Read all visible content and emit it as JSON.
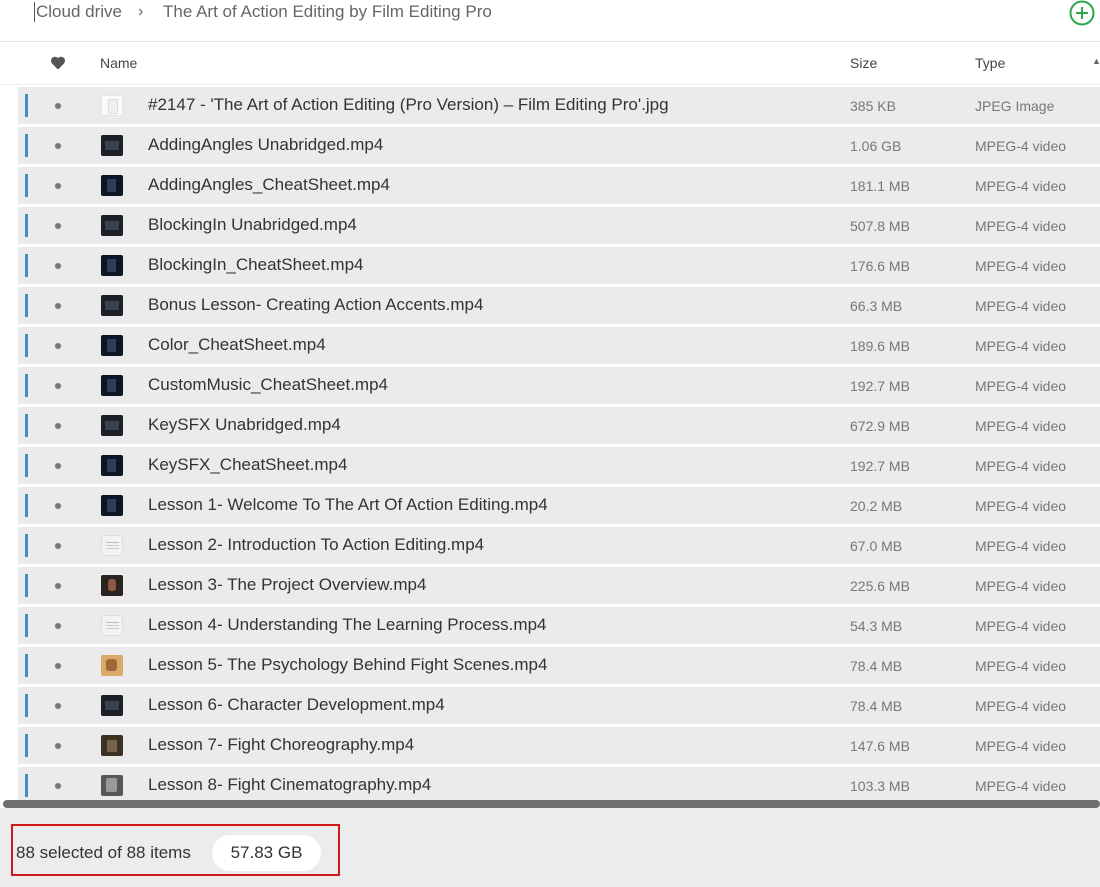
{
  "breadcrumb": {
    "root": "Cloud drive",
    "separator": "›",
    "current": "The Art of Action Editing by Film Editing Pro"
  },
  "header": {
    "favorite_icon": "heart-icon",
    "name": "Name",
    "size": "Size",
    "type": "Type",
    "sort_icon": "sort-ascending-icon"
  },
  "colors": {
    "accent": "#2ba84a",
    "row_marker": "#3f8fc0",
    "row_bg": "#ebebeb",
    "highlight_border": "#d01919"
  },
  "files": [
    {
      "name": "#2147 - 'The Art of Action Editing (Pro Version) – Film Editing Pro'.jpg",
      "size": "385 KB",
      "type": "JPEG Image",
      "thumb": "white"
    },
    {
      "name": "AddingAngles Unabridged.mp4",
      "size": "1.06 GB",
      "type": "MPEG-4 video",
      "thumb": "dark"
    },
    {
      "name": "AddingAngles_CheatSheet.mp4",
      "size": "181.1 MB",
      "type": "MPEG-4 video",
      "thumb": "blue"
    },
    {
      "name": "BlockingIn Unabridged.mp4",
      "size": "507.8 MB",
      "type": "MPEG-4 video",
      "thumb": "dark"
    },
    {
      "name": "BlockingIn_CheatSheet.mp4",
      "size": "176.6 MB",
      "type": "MPEG-4 video",
      "thumb": "blue"
    },
    {
      "name": "Bonus Lesson- Creating Action Accents.mp4",
      "size": "66.3 MB",
      "type": "MPEG-4 video",
      "thumb": "dark"
    },
    {
      "name": "Color_CheatSheet.mp4",
      "size": "189.6 MB",
      "type": "MPEG-4 video",
      "thumb": "blue"
    },
    {
      "name": "CustomMusic_CheatSheet.mp4",
      "size": "192.7 MB",
      "type": "MPEG-4 video",
      "thumb": "blue"
    },
    {
      "name": "KeySFX Unabridged.mp4",
      "size": "672.9 MB",
      "type": "MPEG-4 video",
      "thumb": "dark"
    },
    {
      "name": "KeySFX_CheatSheet.mp4",
      "size": "192.7 MB",
      "type": "MPEG-4 video",
      "thumb": "blue"
    },
    {
      "name": "Lesson 1- Welcome To The Art Of Action Editing.mp4",
      "size": "20.2 MB",
      "type": "MPEG-4 video",
      "thumb": "blue"
    },
    {
      "name": "Lesson 2- Introduction To Action Editing.mp4",
      "size": "67.0 MB",
      "type": "MPEG-4 video",
      "thumb": "light"
    },
    {
      "name": "Lesson 3- The Project Overview.mp4",
      "size": "225.6 MB",
      "type": "MPEG-4 video",
      "thumb": "face"
    },
    {
      "name": "Lesson 4- Understanding The Learning Process.mp4",
      "size": "54.3 MB",
      "type": "MPEG-4 video",
      "thumb": "light"
    },
    {
      "name": "Lesson 5- The Psychology Behind Fight Scenes.mp4",
      "size": "78.4 MB",
      "type": "MPEG-4 video",
      "thumb": "warm"
    },
    {
      "name": "Lesson 6- Character Development.mp4",
      "size": "78.4 MB",
      "type": "MPEG-4 video",
      "thumb": "dark"
    },
    {
      "name": "Lesson 7- Fight Choreography.mp4",
      "size": "147.6 MB",
      "type": "MPEG-4 video",
      "thumb": "brown"
    },
    {
      "name": "Lesson 8- Fight Cinematography.mp4",
      "size": "103.3 MB",
      "type": "MPEG-4 video",
      "thumb": "gray"
    }
  ],
  "status": {
    "selection": "88 selected of 88 items",
    "total_size": "57.83 GB"
  }
}
